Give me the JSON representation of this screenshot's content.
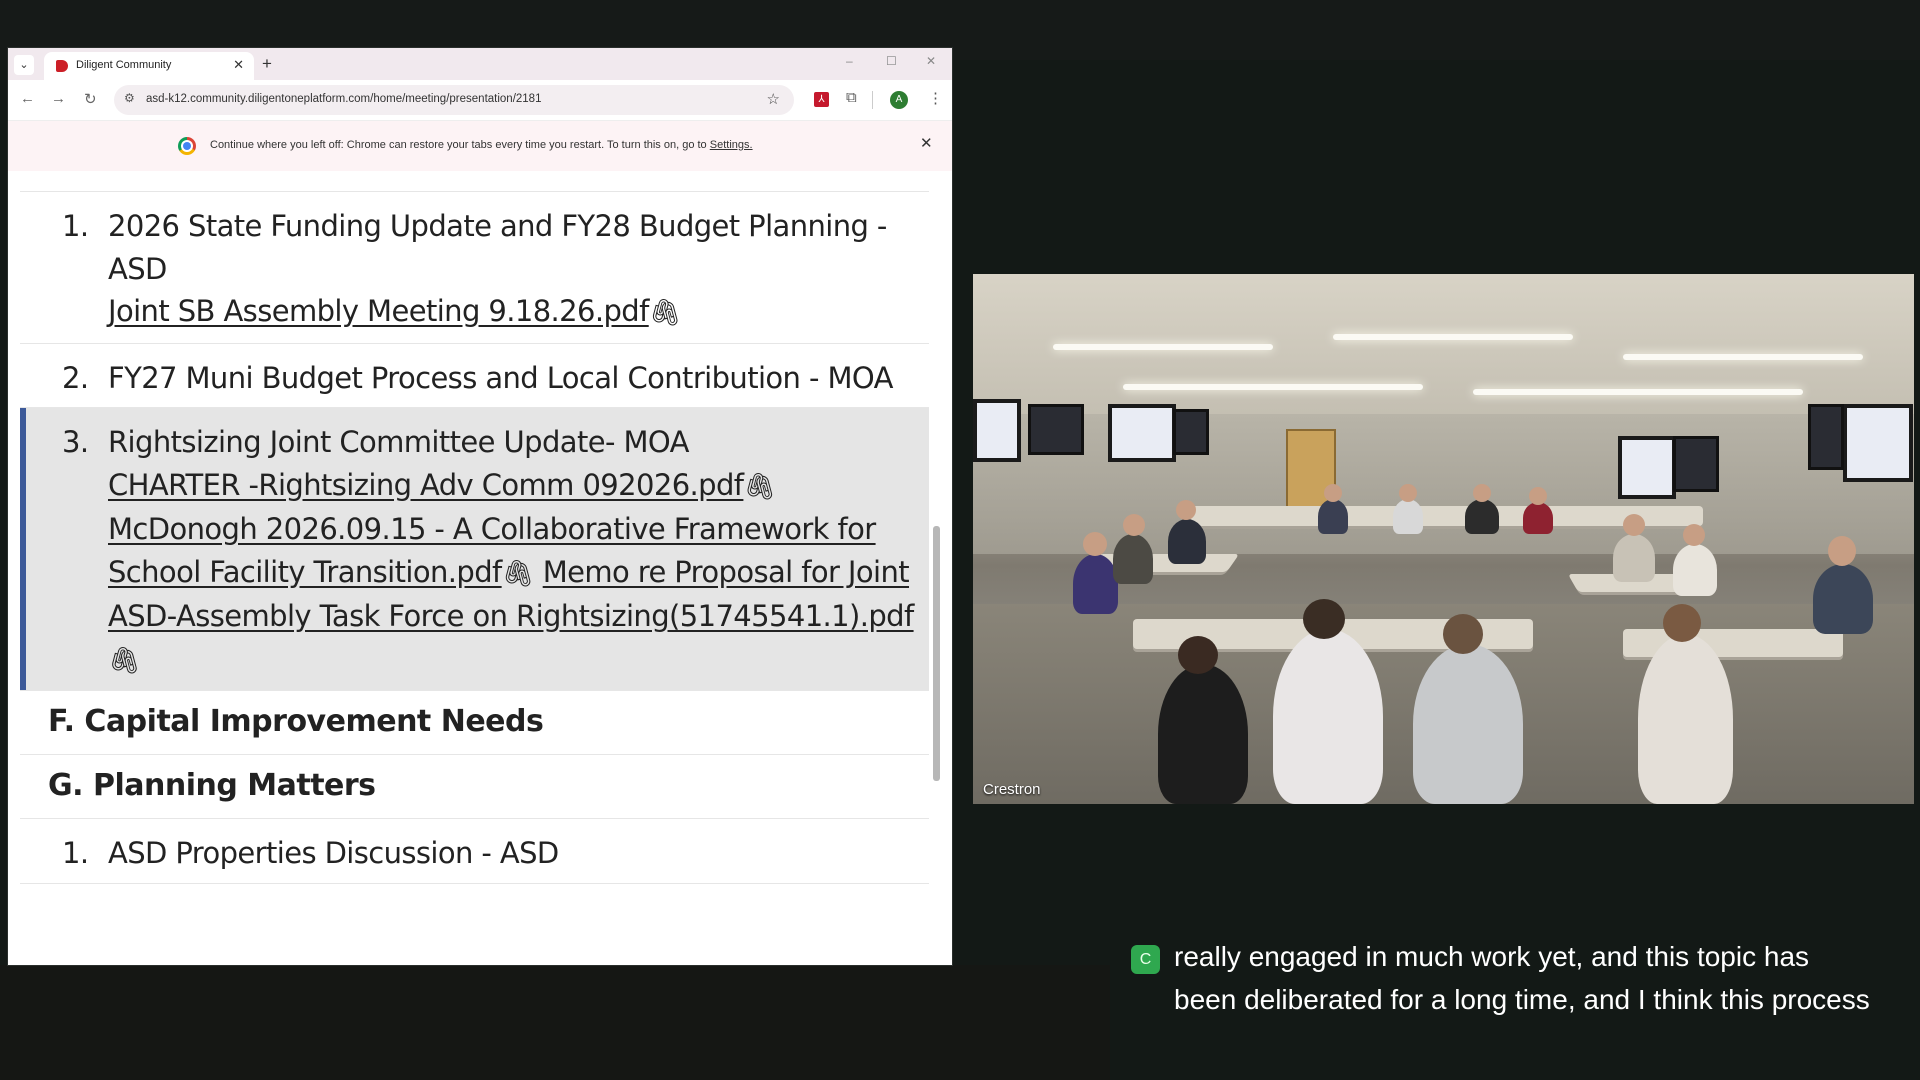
{
  "browser": {
    "tab": {
      "title": "Diligent Community",
      "close": "✕"
    },
    "new_tab": "+",
    "window_controls": {
      "minimize": "–",
      "maximize": "☐",
      "close": "✕"
    },
    "address": "asd-k12.community.diligentoneplatform.com/home/meeting/presentation/2181",
    "profile_initial": "A",
    "infobar": {
      "text": "Continue where you left off: Chrome can restore your tabs every time you restart. To turn this on, go to",
      "link": "Settings."
    }
  },
  "agenda": {
    "items_top": [
      {
        "number": "1.",
        "title": "2026 State Funding Update and FY28 Budget Planning - ASD",
        "attachments": [
          "Joint SB Assembly Meeting 9.18.26.pdf"
        ]
      },
      {
        "number": "2.",
        "title": "FY27 Muni Budget Process and Local Contribution - MOA",
        "attachments": []
      },
      {
        "number": "3.",
        "title": "Rightsizing Joint Committee Update- MOA",
        "attachments": [
          "CHARTER -Rightsizing Adv Comm 092026.pdf",
          "McDonogh 2026.09.15 - A Collaborative Framework for School Facility Transition.pdf",
          "Memo re Proposal for Joint ASD-Assembly Task Force on Rightsizing(51745541.1).pdf"
        ],
        "selected": true
      }
    ],
    "sections": [
      {
        "label": "F. Capital Improvement Needs"
      },
      {
        "label": "G. Planning Matters"
      }
    ],
    "items_bottom": [
      {
        "number": "1.",
        "title": "ASD Properties Discussion - ASD"
      }
    ]
  },
  "video": {
    "label": "Crestron"
  },
  "caption": {
    "speaker_initial": "C",
    "text": "really engaged in much work yet, and this topic has been deliberated for a long time, and I think this process"
  },
  "colors": {
    "selected_accent": "#3d5a99",
    "caption_badge": "#2fa84f",
    "background": "#131916"
  },
  "icons": [
    "tab-search-icon",
    "back-icon",
    "forward-icon",
    "reload-icon",
    "site-info-icon",
    "bookmark-star-icon",
    "acrobat-icon",
    "extensions-icon",
    "kebab-menu-icon",
    "paperclip-icon",
    "chrome-logo-icon"
  ]
}
